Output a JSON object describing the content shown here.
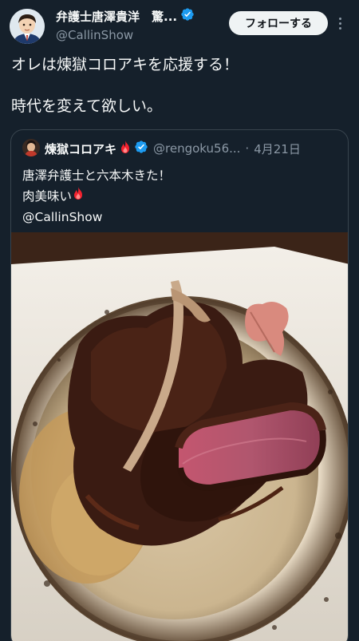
{
  "author": {
    "name": "弁護士唐澤貴洋　驚...",
    "handle": "@CallinShow",
    "verified": true,
    "avatar_icon": "cartoon-lawyer-avatar"
  },
  "actions": {
    "follow_label": "フォローする",
    "more_icon": "more-options-icon"
  },
  "tweet": {
    "text": "オレは煉獄コロアキを応援する！\n\n時代を変えて欲しい。"
  },
  "quoted": {
    "name": "煉獄コロアキ",
    "name_emoji": "fire-icon",
    "verified": true,
    "handle": "@rengoku56...",
    "separator": "·",
    "date": "4月21日",
    "line1": "唐澤弁護士と六本木きた！",
    "line2": "肉美味い",
    "line2_emoji": "fire-icon",
    "line3": "@CallinShow",
    "image": "steak-photo",
    "colors": {
      "accent": "#1d9bf0",
      "fire": "#e0245e"
    }
  }
}
